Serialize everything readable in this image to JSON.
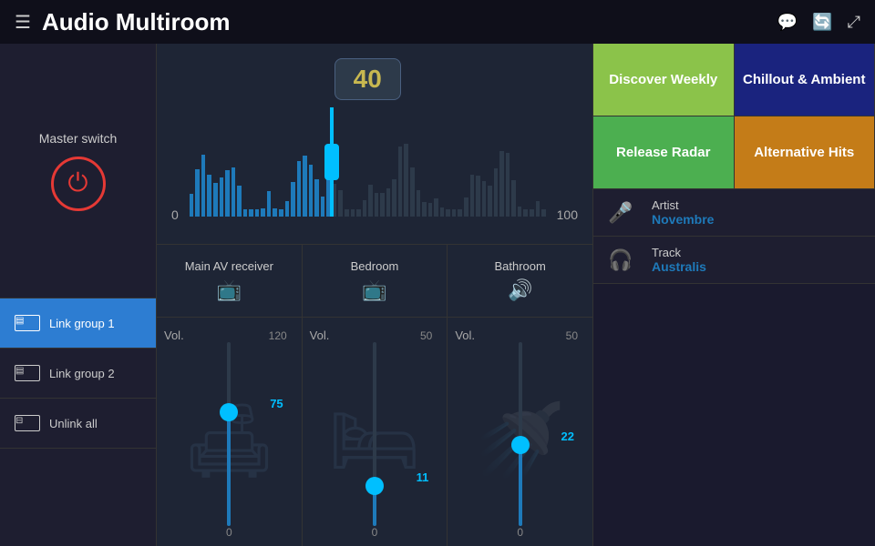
{
  "header": {
    "menu_icon": "☰",
    "title": "Audio Multiroom",
    "icons": [
      "💬",
      "🔄",
      "⤢"
    ]
  },
  "sidebar": {
    "master_switch_label": "Master switch",
    "groups": [
      {
        "id": "group1",
        "label": "Link group 1",
        "active": true
      },
      {
        "id": "group2",
        "label": "Link group 2",
        "active": false
      },
      {
        "id": "unlink",
        "label": "Unlink all",
        "active": false
      }
    ]
  },
  "volume_bar": {
    "value": "40",
    "min": "0",
    "max": "100",
    "fill_percent": 40
  },
  "rooms": [
    {
      "id": "main-av",
      "label": "Main AV receiver",
      "icon": "📺"
    },
    {
      "id": "bedroom",
      "label": "Bedroom",
      "icon": "📺"
    },
    {
      "id": "bathroom",
      "label": "Bathroom",
      "icon": "🔊"
    }
  ],
  "vol_controls": [
    {
      "id": "main-av-vol",
      "label": "Vol.",
      "max": "120",
      "value": "75",
      "fill_pct": 62
    },
    {
      "id": "bedroom-vol",
      "label": "Vol.",
      "max": "50",
      "value": "11",
      "fill_pct": 22
    },
    {
      "id": "bathroom-vol",
      "label": "Vol.",
      "max": "50",
      "value": "22",
      "fill_pct": 44
    }
  ],
  "playlists": [
    {
      "id": "discover-weekly",
      "label": "Discover Weekly",
      "style": "green"
    },
    {
      "id": "chillout-ambient",
      "label": "Chillout & Ambient",
      "style": "dark-blue"
    },
    {
      "id": "release-radar",
      "label": "Release Radar",
      "style": "bright-green"
    },
    {
      "id": "alternative-hits",
      "label": "Alternative Hits",
      "style": "amber"
    }
  ],
  "track_info": [
    {
      "id": "artist",
      "icon": "🎤",
      "title": "Artist",
      "value": "Novembre"
    },
    {
      "id": "track",
      "icon": "🎧",
      "title": "Track",
      "value": "Australis"
    }
  ],
  "bars_count": 60
}
